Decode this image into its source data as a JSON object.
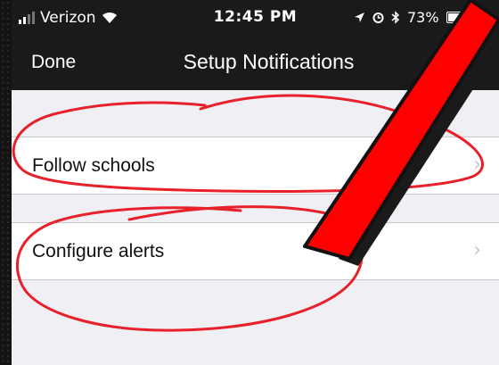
{
  "status_bar": {
    "carrier": "Verizon",
    "time": "12:45 PM",
    "battery": "73%",
    "icons": [
      "signal-bars-icon",
      "wifi-icon",
      "location-arrow-icon",
      "alarm-icon",
      "bluetooth-icon",
      "battery-icon"
    ]
  },
  "nav": {
    "done_label": "Done",
    "title": "Setup Notifications"
  },
  "rows": [
    {
      "label": "Follow schools",
      "icon": "chevron-right-icon"
    },
    {
      "label": "Configure alerts",
      "icon": "chevron-right-icon"
    }
  ],
  "annotations": {
    "circle_color": "#e8202a",
    "slash_color": "#ff0000"
  },
  "colors": {
    "bar_background": "#1a1a1a",
    "page_background": "#efeff4",
    "row_background": "#ffffff",
    "chevron": "#c7c7cc"
  }
}
